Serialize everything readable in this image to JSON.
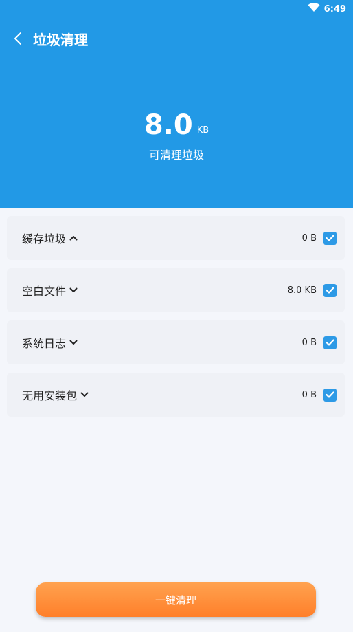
{
  "status": {
    "time": "6:49"
  },
  "header": {
    "title": "垃圾清理",
    "amount_value": "8.0",
    "amount_unit": "KB",
    "amount_caption": "可清理垃圾"
  },
  "categories": [
    {
      "label": "缓存垃圾",
      "size": "0 B",
      "expanded": true,
      "checked": true
    },
    {
      "label": "空白文件",
      "size": "8.0 KB",
      "expanded": false,
      "checked": true
    },
    {
      "label": "系统日志",
      "size": "0 B",
      "expanded": false,
      "checked": true
    },
    {
      "label": "无用安装包",
      "size": "0 B",
      "expanded": false,
      "checked": true
    }
  ],
  "action": {
    "clean_label": "一键清理"
  },
  "colors": {
    "header_bg": "#2299e6",
    "checkbox": "#2d9ae6",
    "button_gradient_top": "#ffa24f",
    "button_gradient_bottom": "#ff7f2a",
    "page_bg": "#f4f6fb",
    "card_bg": "#eff1f6"
  },
  "icons": {
    "back": "chevron-left-icon",
    "wifi": "wifi-icon",
    "expanded": "chevron-up-icon",
    "collapsed": "chevron-down-icon",
    "checkbox": "checkbox-checked-icon"
  }
}
